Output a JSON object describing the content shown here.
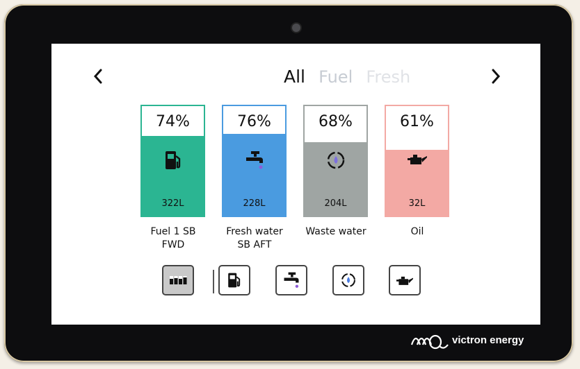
{
  "nav": {
    "prev_icon": "chevron-left-icon",
    "next_icon": "chevron-right-icon",
    "prev_glyph": "‹",
    "next_glyph": "›"
  },
  "tabs": [
    {
      "label": "All",
      "active": true
    },
    {
      "label": "Fuel",
      "active": false
    },
    {
      "label": "Fresh",
      "active": false
    }
  ],
  "tanks": [
    {
      "percent_label": "74%",
      "level": 0.74,
      "volume": "322L",
      "label_line1": "Fuel 1 SB",
      "label_line2": "FWD",
      "fill_color": "#2bb592",
      "border_color": "#2bb592",
      "icon": "fuel-pump-icon"
    },
    {
      "percent_label": "76%",
      "level": 0.76,
      "volume": "228L",
      "label_line1": "Fresh water",
      "label_line2": "SB AFT",
      "fill_color": "#4a9be0",
      "border_color": "#4a9be0",
      "icon": "water-tap-icon"
    },
    {
      "percent_label": "68%",
      "level": 0.68,
      "volume": "204L",
      "label_line1": "Waste water",
      "label_line2": "",
      "fill_color": "#9fa5a3",
      "border_color": "#9fa5a3",
      "icon": "waste-water-icon"
    },
    {
      "percent_label": "61%",
      "level": 0.61,
      "volume": "32L",
      "label_line1": "Oil",
      "label_line2": "",
      "fill_color": "#f3a9a4",
      "border_color": "#f3a9a4",
      "icon": "oil-can-icon"
    }
  ],
  "filter_buttons": [
    {
      "icon": "all-tanks-icon",
      "selected": true
    },
    {
      "icon": "fuel-pump-icon",
      "selected": false
    },
    {
      "icon": "water-tap-icon",
      "selected": false
    },
    {
      "icon": "waste-water-icon",
      "selected": false
    },
    {
      "icon": "oil-can-icon",
      "selected": false
    }
  ],
  "brand": {
    "name": "victron energy",
    "logo_icon": "victron-logo-icon"
  }
}
